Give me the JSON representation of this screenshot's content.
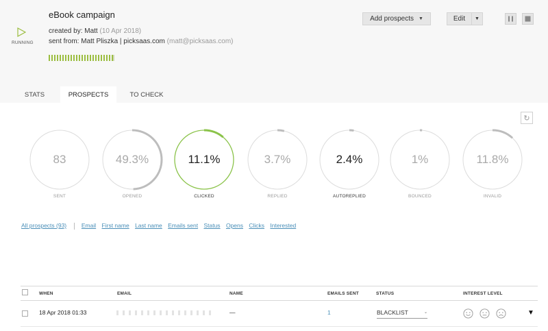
{
  "campaign": {
    "status_label": "RUNNING",
    "title": "eBook campaign",
    "created_prefix": "created by: Matt",
    "created_date": "(10 Apr 2018)",
    "sent_from_prefix": "sent from: Matt Pliszka | picksaas.com",
    "sent_from_email": "(matt@picksaas.com)",
    "progress": 0.98
  },
  "actions": {
    "add_prospects": "Add prospects",
    "edit": "Edit"
  },
  "tabs": [
    {
      "label": "STATS",
      "active": false
    },
    {
      "label": "PROSPECTS",
      "active": true
    },
    {
      "label": "TO CHECK",
      "active": false
    }
  ],
  "stats": [
    {
      "value": "83",
      "label": "SENT",
      "progress": 0,
      "highlight": false
    },
    {
      "value": "49.3%",
      "label": "OPENED",
      "progress": 0.493,
      "highlight": false
    },
    {
      "value": "11.1%",
      "label": "CLICKED",
      "progress": 0.111,
      "highlight": true
    },
    {
      "value": "3.7%",
      "label": "REPLIED",
      "progress": 0.037,
      "highlight": false
    },
    {
      "value": "2.4%",
      "label": "AUTOREPLIED",
      "progress": 0.024,
      "highlight": false,
      "dark": true
    },
    {
      "value": "1%",
      "label": "BOUNCED",
      "progress": 0.012,
      "highlight": false
    },
    {
      "value": "11.8%",
      "label": "INVALID",
      "progress": 0.118,
      "highlight": false
    }
  ],
  "filters": {
    "all": "All prospects (93)",
    "columns": [
      "Email",
      "First name",
      "Last name",
      "Emails sent",
      "Status",
      "Opens",
      "Clicks",
      "Interested"
    ]
  },
  "table": {
    "headers": {
      "when": "WHEN",
      "email": "EMAIL",
      "name": "NAME",
      "emails_sent": "EMAILS SENT",
      "status": "STATUS",
      "interest": "INTEREST LEVEL"
    },
    "rows": [
      {
        "when": "18 Apr 2018 01:33",
        "name": "—",
        "emails_sent": "1",
        "status": "BLACKLIST"
      }
    ]
  },
  "colors": {
    "accent_green": "#8bc34a",
    "progress_green": "#9bbd3f",
    "link_blue": "#4a8fb8"
  }
}
